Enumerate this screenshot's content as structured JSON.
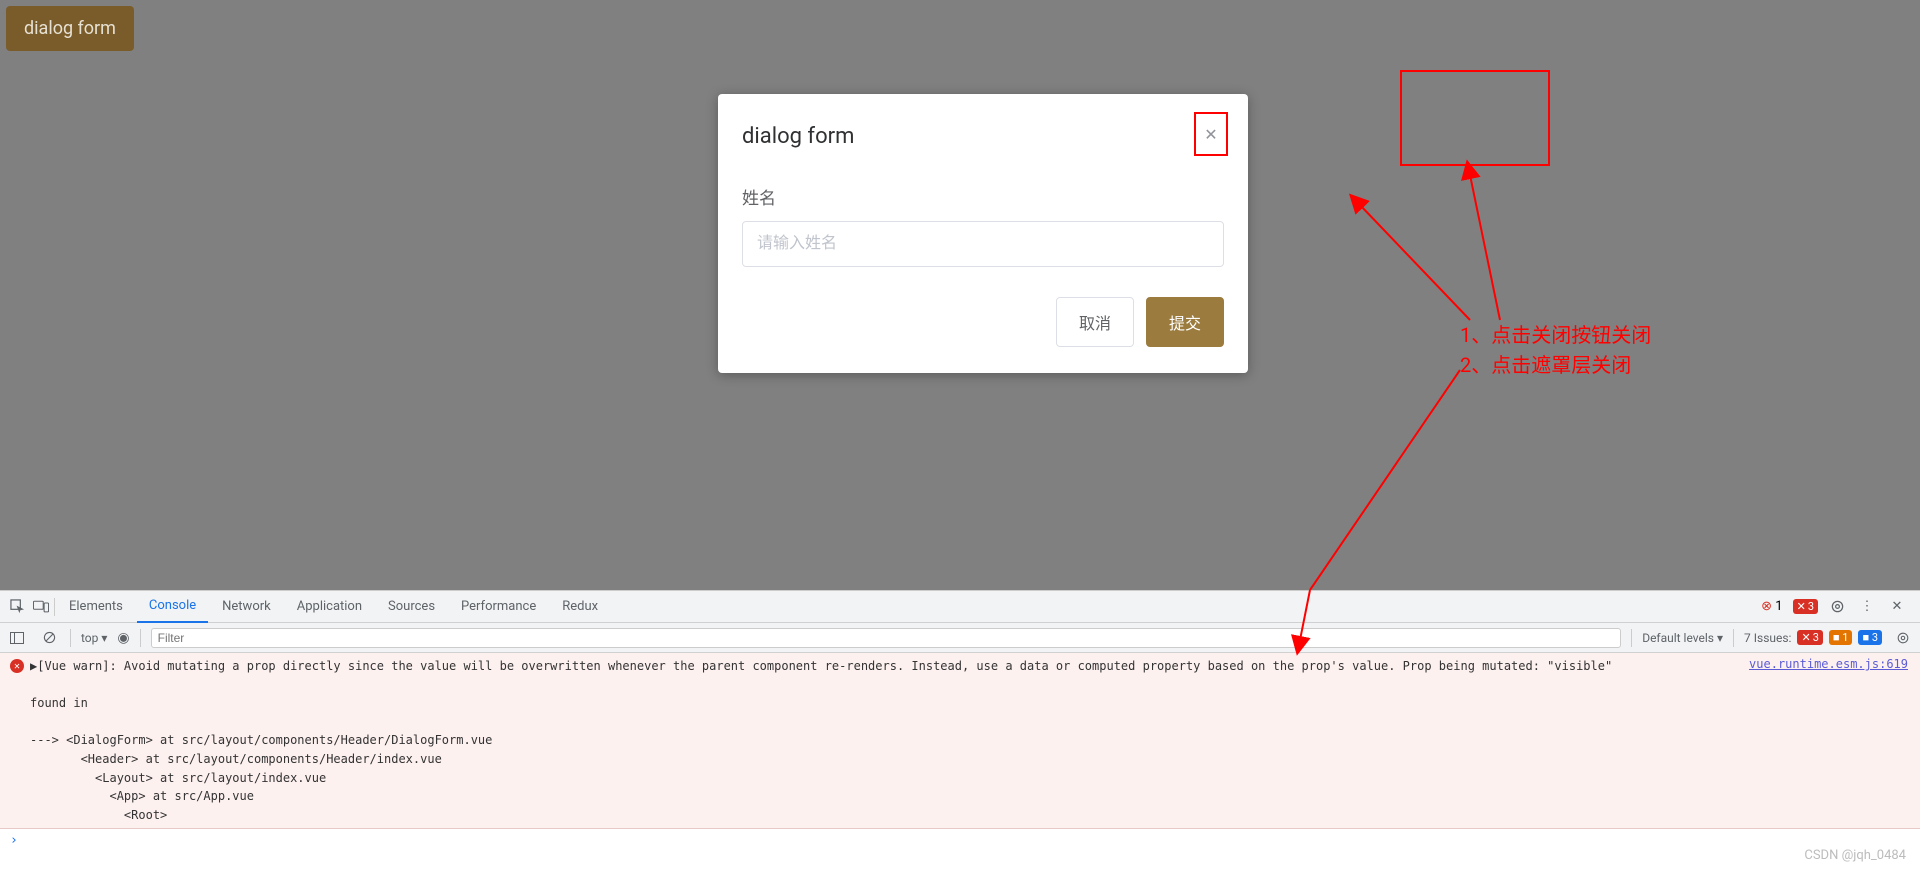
{
  "app": {
    "trigger_button": "dialog form"
  },
  "dialog": {
    "title": "dialog form",
    "form": {
      "name_label": "姓名",
      "name_placeholder": "请输入姓名"
    },
    "footer": {
      "cancel": "取消",
      "submit": "提交"
    }
  },
  "annotations": {
    "line1": "1、点击关闭按钮关闭",
    "line2": "2、点击遮罩层关闭"
  },
  "devtools": {
    "tabs": {
      "elements": "Elements",
      "console": "Console",
      "network": "Network",
      "application": "Application",
      "sources": "Sources",
      "performance": "Performance",
      "redux": "Redux"
    },
    "topright": {
      "error_count": "1",
      "warn_count": "3"
    },
    "filterbar": {
      "top": "top",
      "filter_placeholder": "Filter",
      "levels": "Default levels",
      "issues_label": "7 Issues:",
      "issue_err": "3",
      "issue_warn": "1",
      "issue_info": "3"
    },
    "console": {
      "link": "vue.runtime.esm.js:619",
      "message": "▶[Vue warn]: Avoid mutating a prop directly since the value will be overwritten whenever the parent component re-renders. Instead, use a data or computed property based on the prop's value. Prop being mutated: \"visible\"\n\nfound in\n\n---> <DialogForm> at src/layout/components/Header/DialogForm.vue\n       <Header> at src/layout/components/Header/index.vue\n         <Layout> at src/layout/index.vue\n           <App> at src/App.vue\n             <Root>",
      "prompt": "›"
    }
  },
  "watermark": "CSDN @jqh_0484"
}
